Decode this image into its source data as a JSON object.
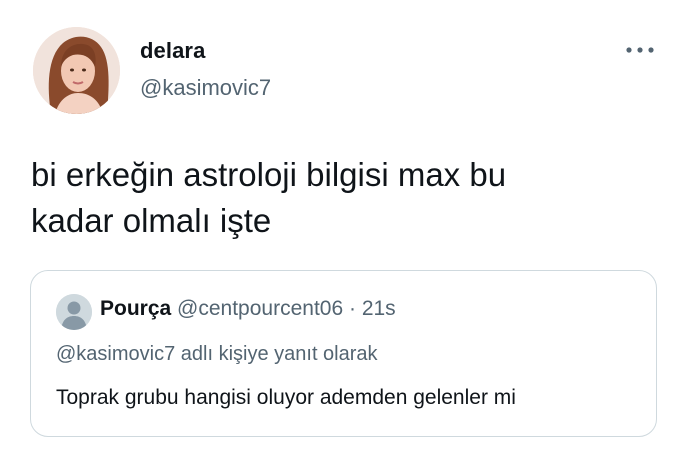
{
  "author": {
    "display_name": "delara",
    "handle": "@kasimovic7",
    "avatar": "profile-photo"
  },
  "more_icon": "more-horizontal-icon",
  "tweet": {
    "text": "bi erkeğin astroloji bilgisi max bu\nkadar olmalı işte"
  },
  "quoted_tweet": {
    "display_name": "Pourça",
    "handle": "@centpourcent06",
    "separator": "·",
    "time": "21s",
    "reply_context": "@kasimovic7 adlı kişiye yanıt olarak",
    "text": "Toprak grubu hangisi oluyor ademden gelenler mi",
    "avatar": "default-profile-icon"
  },
  "colors": {
    "text_primary": "#0f1419",
    "text_secondary": "#536471",
    "border": "#cfd9de"
  }
}
